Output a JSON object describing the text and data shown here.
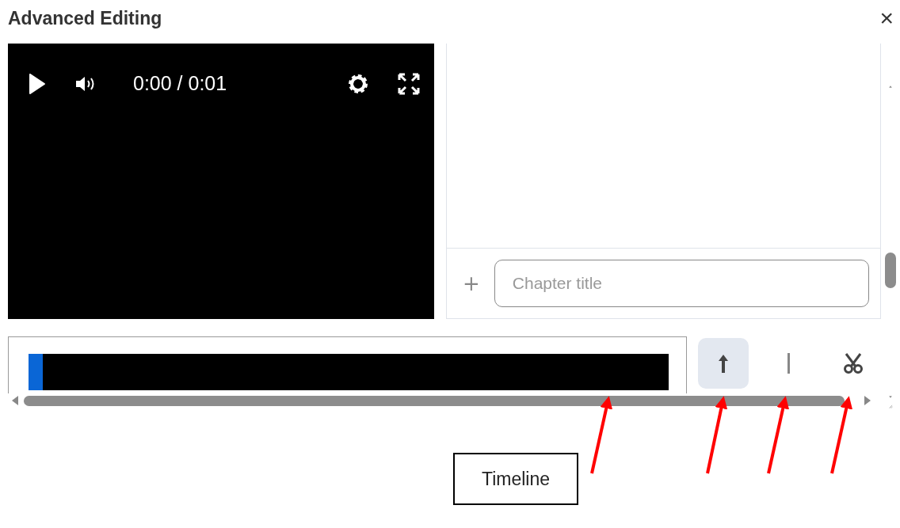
{
  "dialog": {
    "title": "Advanced Editing",
    "close": "×"
  },
  "player": {
    "time": "0:00 / 0:01"
  },
  "chapters": {
    "add": "+",
    "placeholder": "Chapter title"
  },
  "tools": [
    {
      "kind": "up",
      "selected": true
    },
    {
      "kind": "mark",
      "selected": false
    },
    {
      "kind": "cut",
      "selected": false
    }
  ],
  "callout": {
    "label": "Timeline"
  }
}
